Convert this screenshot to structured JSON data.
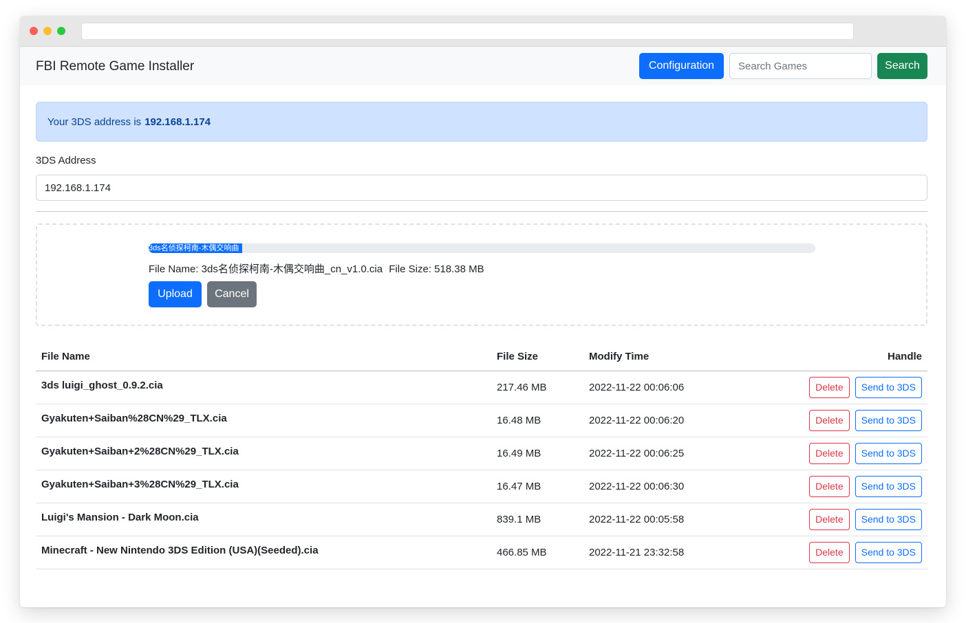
{
  "navbar": {
    "brand": "FBI Remote Game Installer",
    "config_label": "Configuration",
    "search_placeholder": "Search Games",
    "search_label": "Search"
  },
  "alert": {
    "prefix": "Your 3DS address is",
    "address": "192.168.1.174"
  },
  "address_form": {
    "label": "3DS Address",
    "value": "192.168.1.174"
  },
  "upload": {
    "progress_text": "3ds名侦探柯南-木偶交响曲",
    "progress_fraction": 0.14,
    "file_name_text": "File Name: 3ds名侦探柯南-木偶交响曲_cn_v1.0.cia",
    "file_size_text": "File Size: 518.38 MB",
    "upload_label": "Upload",
    "cancel_label": "Cancel"
  },
  "table": {
    "headers": {
      "name": "File Name",
      "size": "File Size",
      "time": "Modify Time",
      "handle": "Handle"
    },
    "delete_label": "Delete",
    "send_label": "Send to 3DS",
    "rows": [
      {
        "name": "3ds luigi_ghost_0.9.2.cia",
        "size": "217.46 MB",
        "time": "2022-11-22 00:06:06"
      },
      {
        "name": "Gyakuten+Saiban%28CN%29_TLX.cia",
        "size": "16.48 MB",
        "time": "2022-11-22 00:06:20"
      },
      {
        "name": "Gyakuten+Saiban+2%28CN%29_TLX.cia",
        "size": "16.49 MB",
        "time": "2022-11-22 00:06:25"
      },
      {
        "name": "Gyakuten+Saiban+3%28CN%29_TLX.cia",
        "size": "16.47 MB",
        "time": "2022-11-22 00:06:30"
      },
      {
        "name": "Luigi's Mansion - Dark Moon.cia",
        "size": "839.1 MB",
        "time": "2022-11-22 00:05:58"
      },
      {
        "name": "Minecraft - New Nintendo 3DS Edition (USA)(Seeded).cia",
        "size": "466.85 MB",
        "time": "2022-11-21 23:32:58"
      }
    ]
  },
  "colors": {
    "primary": "#0d6efd",
    "success": "#198754",
    "secondary": "#6c757d",
    "danger": "#dc3545",
    "alert_bg": "#cfe2ff"
  }
}
